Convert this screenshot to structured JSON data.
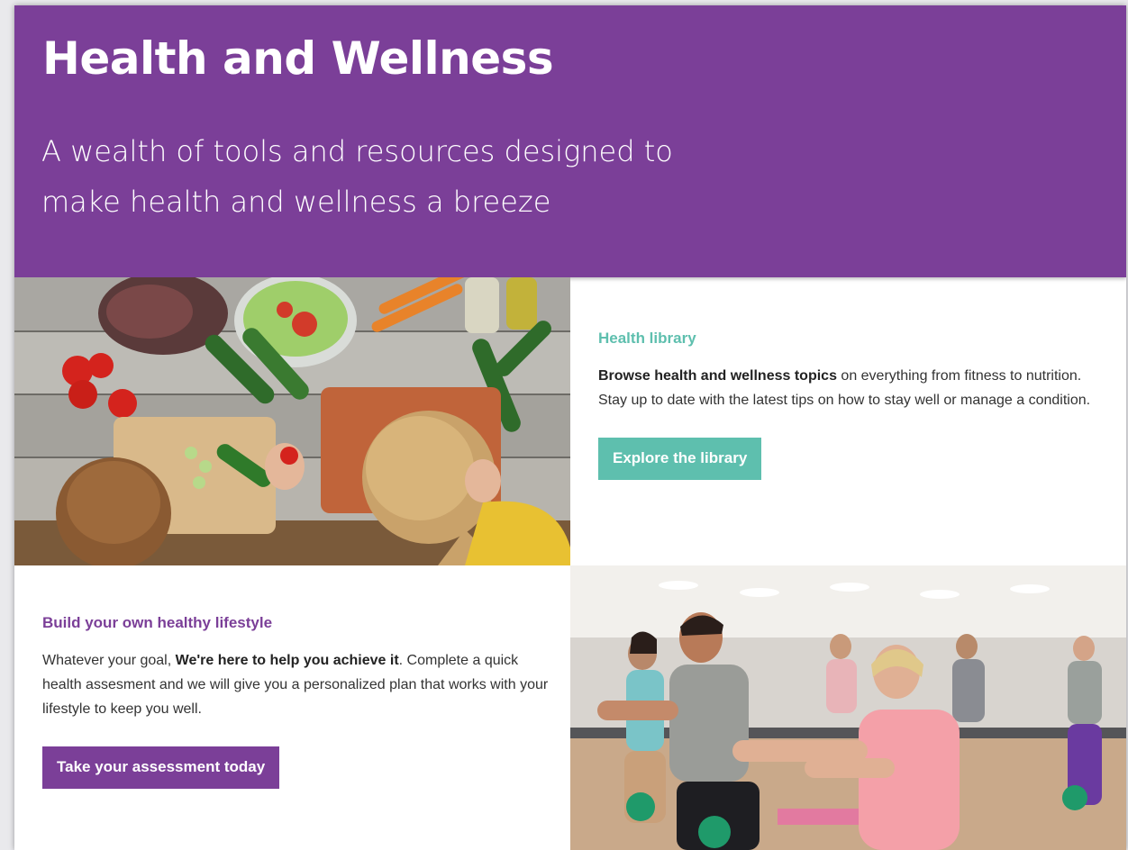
{
  "hero": {
    "title": "Health and Wellness",
    "subtitle_line1": "A wealth of tools and resources designed to",
    "subtitle_line2": "make health and wellness a breeze",
    "background": "#7b3f98"
  },
  "library": {
    "heading": "Health library",
    "body_bold": "Browse health and wellness topics",
    "body_rest": " on everything from fitness to nutrition. Stay up to date with the latest tips on how to stay well or manage a condition.",
    "button_label": "Explore the library",
    "accent": "#5ebfae"
  },
  "lifestyle": {
    "heading": "Build your own healthy lifestyle",
    "body_start": "Whatever your goal, ",
    "body_bold": "We're here to help you achieve it",
    "body_rest": ". Complete a quick health assesment and we will give you a personalized plan that works with your lifestyle to keep you well.",
    "button_label": "Take your assessment today",
    "accent": "#7b3f98"
  },
  "images": {
    "food": "photo-family-preparing-vegetables",
    "fitness": "photo-fitness-class-squats"
  }
}
